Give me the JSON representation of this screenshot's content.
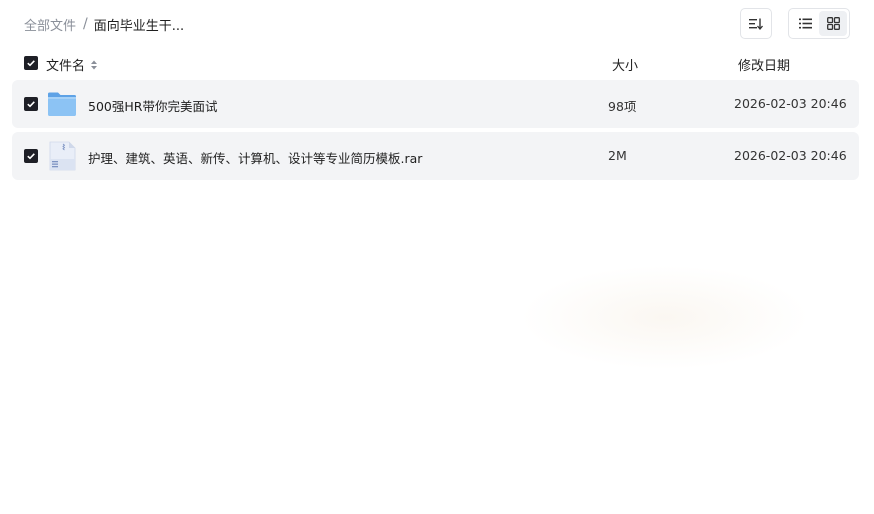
{
  "breadcrumb": {
    "root": "全部文件",
    "separator": "/",
    "current": "面向毕业生干..."
  },
  "toolbar": {
    "sort_icon": "sort-icon",
    "list_view_icon": "list-view-icon",
    "grid_view_icon": "grid-view-icon"
  },
  "columns": {
    "name": "文件名",
    "size": "大小",
    "date": "修改日期"
  },
  "files": [
    {
      "name": "500强HR带你完美面试",
      "size": "98项",
      "date": "2026-02-03 20:46",
      "icon": "folder-icon",
      "checked": true
    },
    {
      "name": "护理、建筑、英语、新传、计算机、设计等专业简历模板.rar",
      "size": "2M",
      "date": "2026-02-03 20:46",
      "icon": "archive-file-icon",
      "checked": true
    }
  ],
  "colors": {
    "accent": "#1e1f26",
    "row_bg": "#f3f4f6",
    "folder": "#7ab8f0"
  }
}
